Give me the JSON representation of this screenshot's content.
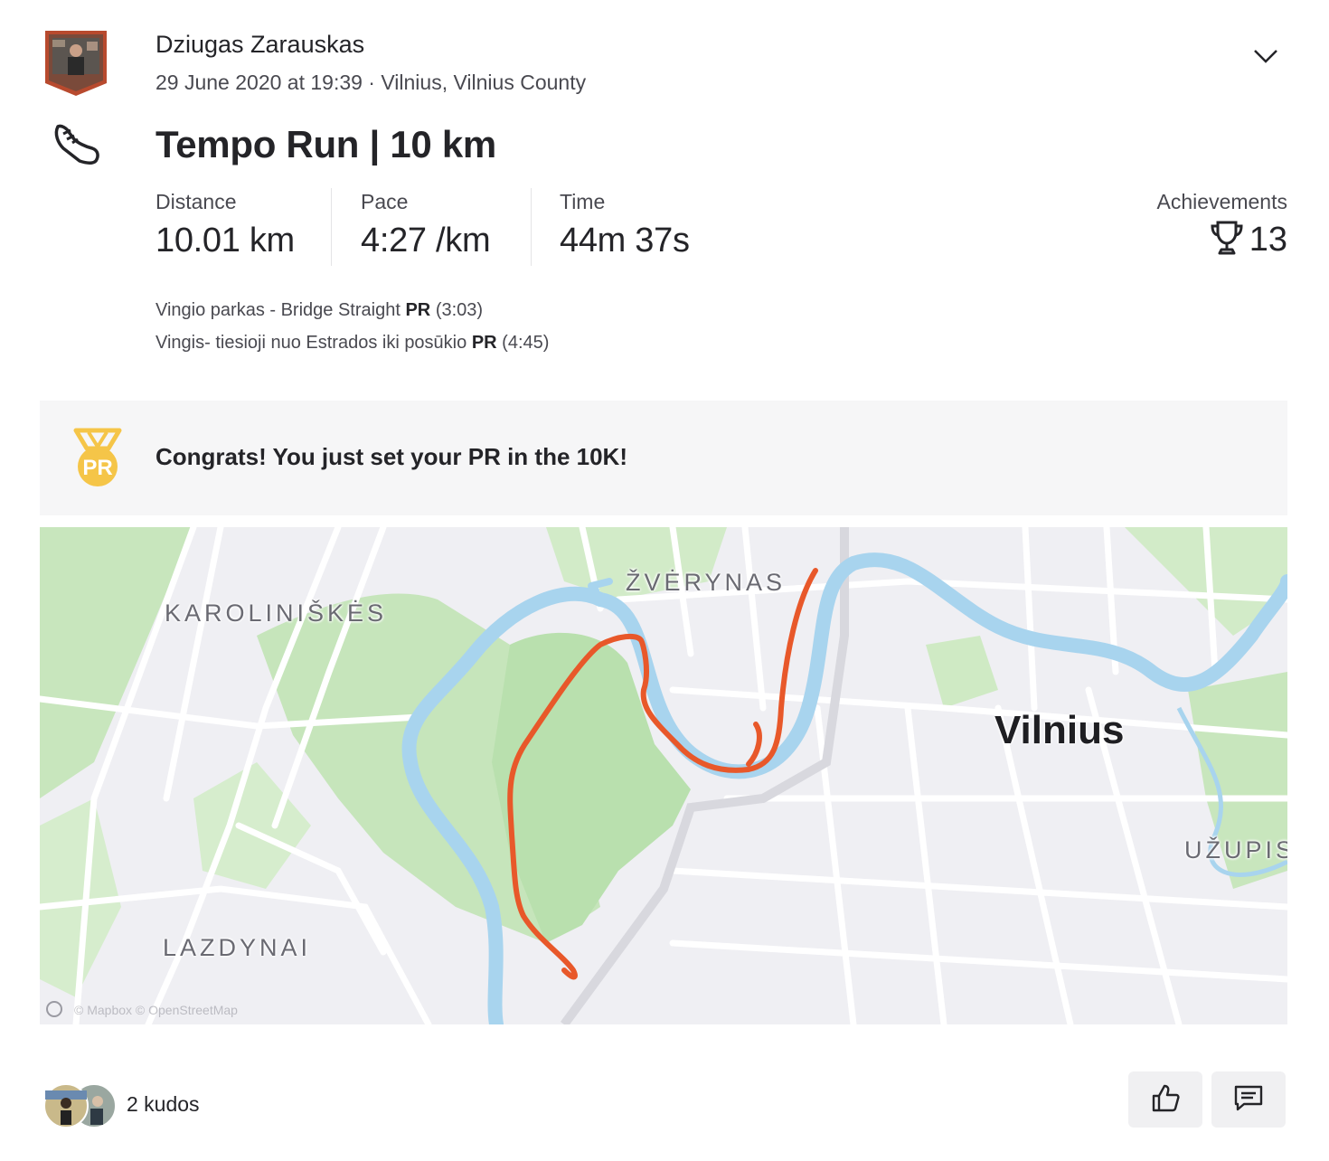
{
  "athlete": {
    "name": "Dziugas Zarauskas"
  },
  "activity": {
    "meta": "29 June 2020 at 19:39 · Vilnius, Vilnius County",
    "title": "Tempo Run | 10 km",
    "sport": "run-shoe-icon"
  },
  "stats": [
    {
      "label": "Distance",
      "value": "10.01 km"
    },
    {
      "label": "Pace",
      "value": "4:27 /km"
    },
    {
      "label": "Time",
      "value": "44m 37s"
    }
  ],
  "achievements": {
    "label": "Achievements",
    "count": "13"
  },
  "segments": [
    {
      "name": "Vingio parkas - Bridge Straight",
      "badge": "PR",
      "time": "(3:03)"
    },
    {
      "name": "Vingis- tiesioji nuo Estrados iki posūkio",
      "badge": "PR",
      "time": "(4:45)"
    }
  ],
  "congrats": {
    "text": "Congrats! You just set your PR in the 10K!",
    "medal_text": "PR",
    "medal_color": "#f5c548"
  },
  "map": {
    "labels": [
      "KAROLINIŠKĖS",
      "ŽVĖRYNAS",
      "Vilnius",
      "UŽUPIS",
      "LAZDYNAI"
    ],
    "credit": "© Mapbox © OpenStreetMap",
    "route_color": "#e8582a",
    "river_color": "#a8d4ee",
    "park_color": "#b9e0ae"
  },
  "kudos": {
    "text": "2 kudos"
  },
  "actions": {
    "kudo": "thumbs-up-icon",
    "comment": "comment-icon"
  }
}
